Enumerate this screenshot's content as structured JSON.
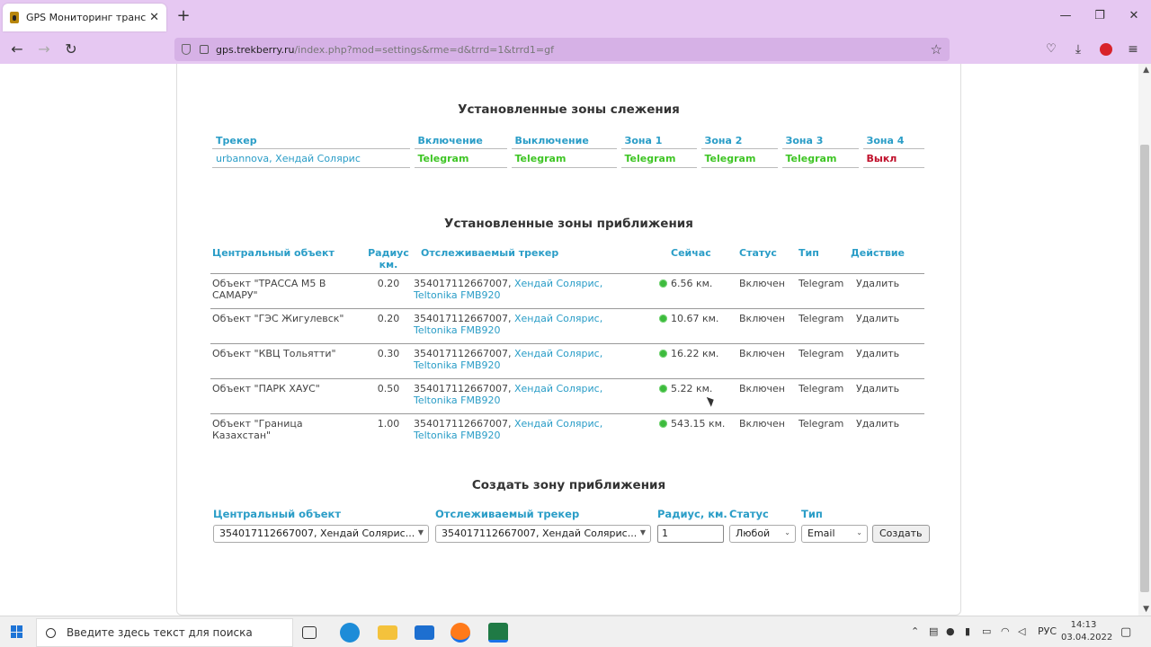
{
  "browser": {
    "tab_title": "GPS Мониторинг транспорта (",
    "tab_close": "✕",
    "new_tab": "+",
    "url_host": "gps.trekberry.ru",
    "url_path": "/index.php?mod=settings&rme=d&trrd=1&trrd1=gf",
    "win_min": "—",
    "win_restore": "❐",
    "win_close": "✕"
  },
  "zones": {
    "title": "Установленные зоны слежения",
    "headers": [
      "Трекер",
      "Включение",
      "Выключение",
      "Зона 1",
      "Зона 2",
      "Зона 3",
      "Зона 4"
    ],
    "row": {
      "tracker_user": "urbannova",
      "tracker_car": "Хендай Солярис",
      "on": "Telegram",
      "off": "Telegram",
      "z1": "Telegram",
      "z2": "Telegram",
      "z3": "Telegram",
      "z4": "Выкл"
    }
  },
  "proximity": {
    "title": "Установленные зоны приближения",
    "headers": {
      "object": "Центральный объект",
      "radius": "Радиус км.",
      "tracker": "Отслеживаемый трекер",
      "now": "Сейчас",
      "status": "Статус",
      "type": "Тип",
      "action": "Действие"
    },
    "rows": [
      {
        "object": "Объект \"ТРАССА М5 В САМАРУ\"",
        "radius": "0.20",
        "imei": "354017112667007,",
        "car": "Хендай Солярис,",
        "model": "Teltonika FMB920",
        "now": "6.56 км.",
        "status": "Включен",
        "type": "Telegram",
        "action": "Удалить"
      },
      {
        "object": "Объект \"ГЭС Жигулевск\"",
        "radius": "0.20",
        "imei": "354017112667007,",
        "car": "Хендай Солярис,",
        "model": "Teltonika FMB920",
        "now": "10.67 км.",
        "status": "Включен",
        "type": "Telegram",
        "action": "Удалить"
      },
      {
        "object": "Объект \"КВЦ Тольятти\"",
        "radius": "0.30",
        "imei": "354017112667007,",
        "car": "Хендай Солярис,",
        "model": "Teltonika FMB920",
        "now": "16.22 км.",
        "status": "Включен",
        "type": "Telegram",
        "action": "Удалить"
      },
      {
        "object": "Объект \"ПАРК ХАУС\"",
        "radius": "0.50",
        "imei": "354017112667007,",
        "car": "Хендай Солярис,",
        "model": "Teltonika FMB920",
        "now": "5.22 км.",
        "status": "Включен",
        "type": "Telegram",
        "action": "Удалить"
      },
      {
        "object": "Объект \"Граница Казахстан\"",
        "radius": "1.00",
        "imei": "354017112667007,",
        "car": "Хендай Солярис,",
        "model": "Teltonika FMB920",
        "now": "543.15 км.",
        "status": "Включен",
        "type": "Telegram",
        "action": "Удалить"
      }
    ]
  },
  "create": {
    "title": "Создать зону приближения",
    "label_object": "Центральный объект",
    "label_tracker": "Отслеживаемый трекер",
    "label_radius": "Радиус, км.",
    "label_status": "Статус",
    "label_type": "Тип",
    "object_value": "354017112667007, Хендай Солярис...",
    "tracker_value": "354017112667007, Хендай Солярис...",
    "radius_value": "1",
    "status_value": "Любой",
    "type_value": "Email",
    "submit": "Создать"
  },
  "taskbar": {
    "search_placeholder": "Введите здесь текст для поиска",
    "lang": "РУС",
    "time": "14:13",
    "date": "03.04.2022"
  },
  "colors": {
    "accent": "#2a9dc7",
    "green": "#3ec524",
    "red": "#dd1133",
    "chrome": "#e6c8f2"
  }
}
